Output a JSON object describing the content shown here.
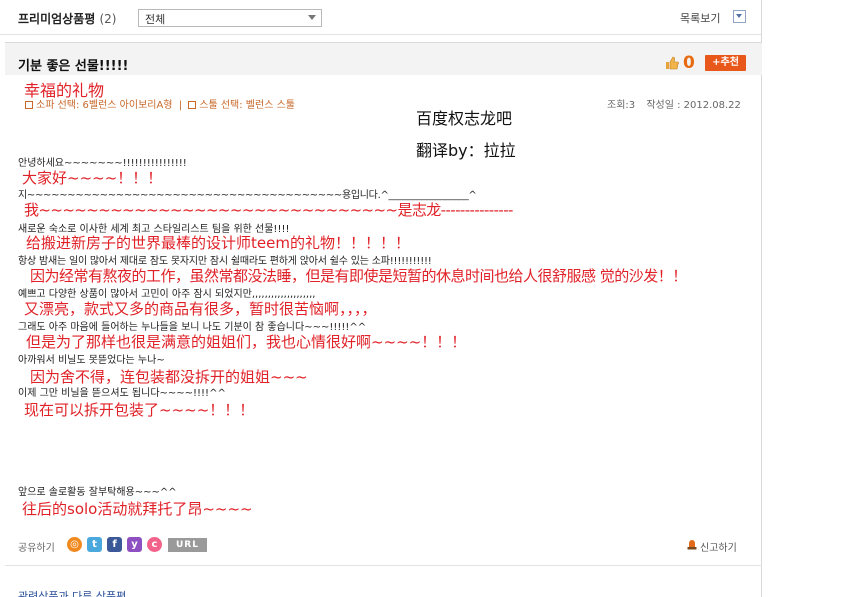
{
  "topbar": {
    "title": "프리미엄상품평",
    "count": "(2)",
    "filter_value": "전체",
    "list_view_label": "목록보기"
  },
  "review": {
    "title": "기분 좋은 선물!!!!!",
    "like_count": "0",
    "recommend_label": "+추천",
    "options": [
      "소파 선택: 6벨런스 아이보리A형",
      "스툴 선택: 벨런스 스툴"
    ],
    "option_separator": "|",
    "views_label": "조회:3",
    "date_label": "작성일 : 2012.08.22",
    "credit": {
      "line1": "百度权志龙吧",
      "line2": "翻译by：拉拉"
    },
    "zh_title": "幸福的礼物",
    "lines": [
      {
        "ko": "안녕하세요~~~~~~~!!!!!!!!!!!!!!!!",
        "zh": "大家好~~~~！！！"
      },
      {
        "ko": "지~~~~~~~~~~~~~~~~~~~~~~~~~~~~~~~~~~~~~~~용입니다.^_________________^",
        "zh": "我~~~~~~~~~~~~~~~~~~~~~~~~~~~~~~是志龙---------------"
      },
      {
        "ko": "새로운 숙소로 이사한 세계 최고 스타일리스트 팀을 위한 선물!!!!",
        "zh": "给搬进新房子的世界最棒的设计师teem的礼物！！！！！"
      },
      {
        "ko": "항상 밤새는 일이 많아서 제대로 잠도 못자지만 잠시 쉴때라도 편하게 앉아서 쉴수 있는 소파!!!!!!!!!!!",
        "zh": "因为经常有熬夜的工作，虽然常都没法睡，但是有即使是短暂的休息时间也给人很舒服感 觉的沙发！！"
      },
      {
        "ko": "예쁘고 다양한 상품이 많아서 고민이 아주 잠시 되었지만,,,,,,,,,,,,,,,,,,,,",
        "zh": "又漂亮，款式又多的商品有很多，暂时很苦恼啊，，，，"
      },
      {
        "ko": "그래도 아주 마음에 들어하는 누나들을 보니 나도 기분이 참 좋습니다~~~!!!!!^^",
        "zh": "但是为了那样也很是满意的姐姐们，我也心情很好啊~~~~！！！"
      },
      {
        "ko": "아까워서 비닐도 못뜯었다는 누나~",
        "zh": "因为舍不得，连包装都没拆开的姐姐~~~"
      },
      {
        "ko": "이제 그만 비닐을 뜯으셔도 됩니다~~~~!!!!^^",
        "zh": "现在可以拆开包装了~~~~！！！"
      },
      {
        "ko": "앞으로 솔로활동 잘부탁해용~~~^^",
        "zh": "往后的solo活动就拜托了昂~~~~"
      }
    ]
  },
  "footer": {
    "share_label": "공유하기",
    "share_icons": [
      "me2day-icon",
      "twitter-icon",
      "facebook-icon",
      "yozm-icon",
      "cyworld-icon"
    ],
    "url_label": "URL",
    "report_label": "신고하기",
    "related_title": "관련상품과 다른 상품평"
  },
  "colors": {
    "accent": "#e8581b",
    "option_text": "#c8682a",
    "chinese_text": "#e02228",
    "header_bg": "#f3f3f3",
    "link": "#2a4f9a"
  }
}
